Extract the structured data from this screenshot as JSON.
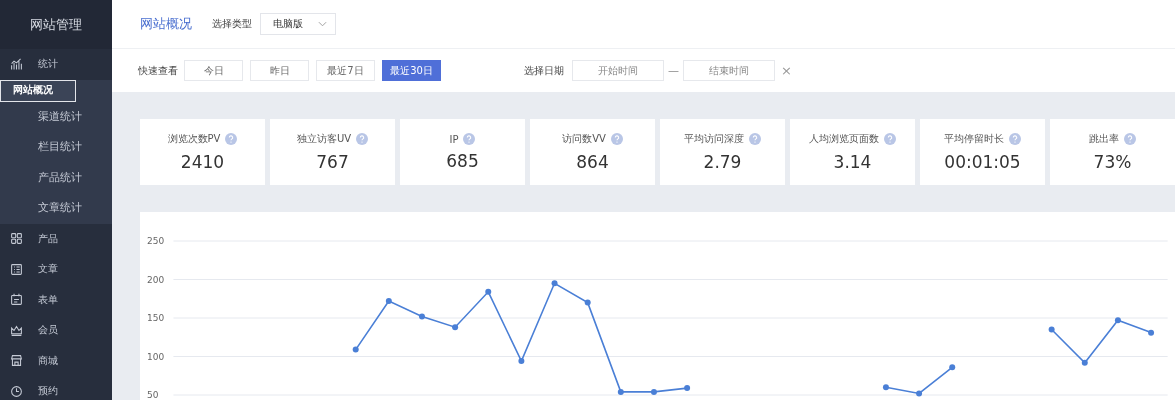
{
  "sidebar": {
    "title": "网站管理",
    "items": [
      {
        "label": "统计",
        "children": [
          {
            "label": "网站概况",
            "selected": true
          },
          {
            "label": "渠道统计",
            "selected": false
          },
          {
            "label": "栏目统计",
            "selected": false
          },
          {
            "label": "产品统计",
            "selected": false
          },
          {
            "label": "文章统计",
            "selected": false
          }
        ]
      },
      {
        "label": "产品"
      },
      {
        "label": "文章"
      },
      {
        "label": "表单"
      },
      {
        "label": "会员"
      },
      {
        "label": "商城"
      },
      {
        "label": "预约"
      }
    ]
  },
  "header": {
    "title": "网站概况",
    "type_label": "选择类型",
    "type_value": "电脑版"
  },
  "filter": {
    "quick_label": "快速查看",
    "quick": [
      {
        "label": "今日",
        "selected": false
      },
      {
        "label": "昨日",
        "selected": false
      },
      {
        "label": "最近7日",
        "selected": false
      },
      {
        "label": "最近30日",
        "selected": true
      }
    ],
    "date_label": "选择日期",
    "start": {
      "placeholder": "开始时间"
    },
    "separator": "—",
    "end": {
      "placeholder": "结束时间"
    },
    "clear": "×"
  },
  "stats": [
    {
      "label": "浏览次数PV",
      "value": "2410"
    },
    {
      "label": "独立访客UV",
      "value": "767"
    },
    {
      "label": "IP",
      "value": "685"
    },
    {
      "label": "访问数VV",
      "value": "864"
    },
    {
      "label": "平均访问深度",
      "value": "2.79"
    },
    {
      "label": "人均浏览页面数",
      "value": "3.14"
    },
    {
      "label": "平均停留时长",
      "value": "00:01:05"
    },
    {
      "label": "跳出率",
      "value": "73%"
    }
  ],
  "chart_data": {
    "type": "line",
    "grid": true,
    "ylim": [
      50,
      250
    ],
    "yticks": [
      50,
      100,
      150,
      200,
      250
    ],
    "series": [
      {
        "color": "#4a7fd6",
        "marker": true,
        "values": [
          null,
          null,
          null,
          null,
          null,
          109,
          172,
          152,
          138,
          184,
          94,
          195,
          170,
          54,
          54,
          59,
          null,
          null,
          null,
          null,
          null,
          60,
          52,
          86,
          null,
          null,
          135,
          92,
          147,
          131
        ]
      }
    ]
  }
}
